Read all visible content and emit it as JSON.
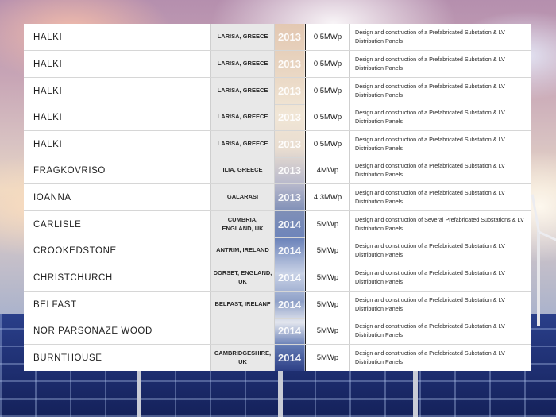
{
  "rows": [
    {
      "name": "HALKI",
      "location": "LARISA, GREECE",
      "year": "2013",
      "power": "0,5MWp",
      "description": "Design and construction of a Prefabricated Substation & LV Distribution Panels"
    },
    {
      "name": "HALKI",
      "location": "LARISA, GREECE",
      "year": "2013",
      "power": "0,5MWp",
      "description": "Design and construction of a Prefabricated Substation & LV Distribution Panels"
    },
    {
      "name": "HALKI",
      "location": "LARISA, GREECE",
      "year": "2013",
      "power": "0,5MWp",
      "description": "Design and construction of a Prefabricated Substation & LV Distribution Panels"
    },
    {
      "name": "HALKI",
      "location": "LARISA, GREECE",
      "year": "2013",
      "power": "0,5MWp",
      "description": "Design and construction of a Prefabricated Substation & LV Distribution Panels"
    },
    {
      "name": "HALKI",
      "location": "LARISA, GREECE",
      "year": "2013",
      "power": "0,5MWp",
      "description": "Design and construction of a Prefabricated Substation & LV Distribution Panels"
    },
    {
      "name": "FRAGKOVRISO",
      "location": "ILIA, GREECE",
      "year": "2013",
      "power": "4MWp",
      "description": "Design and construction of a Prefabricated Substation & LV Distribution Panels"
    },
    {
      "name": "IOANNA",
      "location": "GALARASI",
      "year": "2013",
      "power": "4,3MWp",
      "description": "Design and construction of a Prefabricated Substation & LV Distribution Panels"
    },
    {
      "name": "CARLISLE",
      "location": "CUMBRIA, ENGLAND, UK",
      "year": "2014",
      "power": "5MWp",
      "description": "Design and construction of Several Prefabricated Substations & LV Distribution Panels"
    },
    {
      "name": "CROOKEDSTONE",
      "location": "ANTRIM, IRELAND",
      "year": "2014",
      "power": "5MWp",
      "description": "Design and construction of a Prefabricated Substation & LV Distribution Panels"
    },
    {
      "name": "CHRISTCHURCH",
      "location": "DORSET, ENGLAND, UK",
      "year": "2014",
      "power": "5MWp",
      "description": "Design and construction of a Prefabricated Substation & LV Distribution Panels"
    },
    {
      "name": "BELFAST",
      "location": "BELFAST, IRELANF",
      "year": "2014",
      "power": "5MWp",
      "description": "Design and construction of a Prefabricated Substation & LV Distribution Panels"
    },
    {
      "name": "NOR PARSONAZE WOOD",
      "location": "",
      "year": "2014",
      "power": "5MWp",
      "description": "Design and construction of a Prefabricated Substation & LV Distribution Panels"
    },
    {
      "name": "BURNTHOUSE",
      "location": "CAMBRIDGESHIRE, UK",
      "year": "2014",
      "power": "5MWp",
      "description": "Design and construction of a Prefabricated Substation & LV Distribution Panels"
    }
  ]
}
